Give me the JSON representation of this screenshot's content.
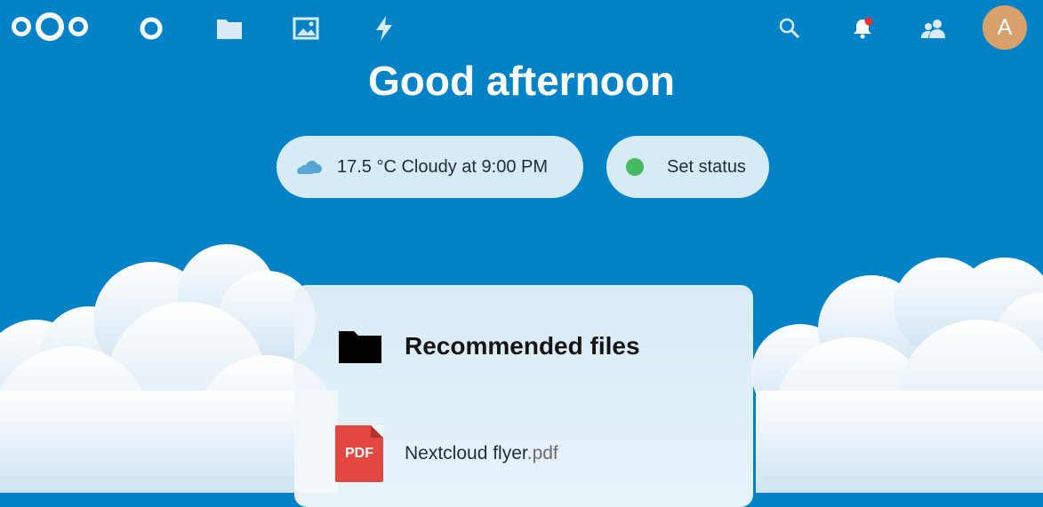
{
  "header": {
    "logo_icon": "nextcloud-logo-icon",
    "nav": [
      {
        "name": "dashboard",
        "icon": "circle-icon"
      },
      {
        "name": "files",
        "icon": "folder-icon"
      },
      {
        "name": "photos",
        "icon": "image-icon"
      },
      {
        "name": "activity",
        "icon": "lightning-icon"
      }
    ],
    "right": [
      {
        "name": "search",
        "icon": "search-icon"
      },
      {
        "name": "notifications",
        "icon": "bell-icon",
        "has_badge": true
      },
      {
        "name": "contacts",
        "icon": "contacts-icon"
      }
    ],
    "avatar_letter": "A"
  },
  "greeting": "Good afternoon",
  "weather": {
    "icon": "cloud-icon",
    "text": "17.5 °C Cloudy at 9:00 PM"
  },
  "status": {
    "label": "Set status",
    "dot_color": "#46ba61"
  },
  "panel": {
    "title": "Recommended files",
    "title_icon": "folder-icon",
    "files": [
      {
        "name": "Nextcloud flyer",
        "ext": ".pdf",
        "icon_label": "PDF",
        "icon_color": "#e2483f"
      }
    ]
  },
  "colors": {
    "primary": "#0082c9",
    "avatar": "#d8a06b",
    "notification_dot": "#e9322d"
  }
}
